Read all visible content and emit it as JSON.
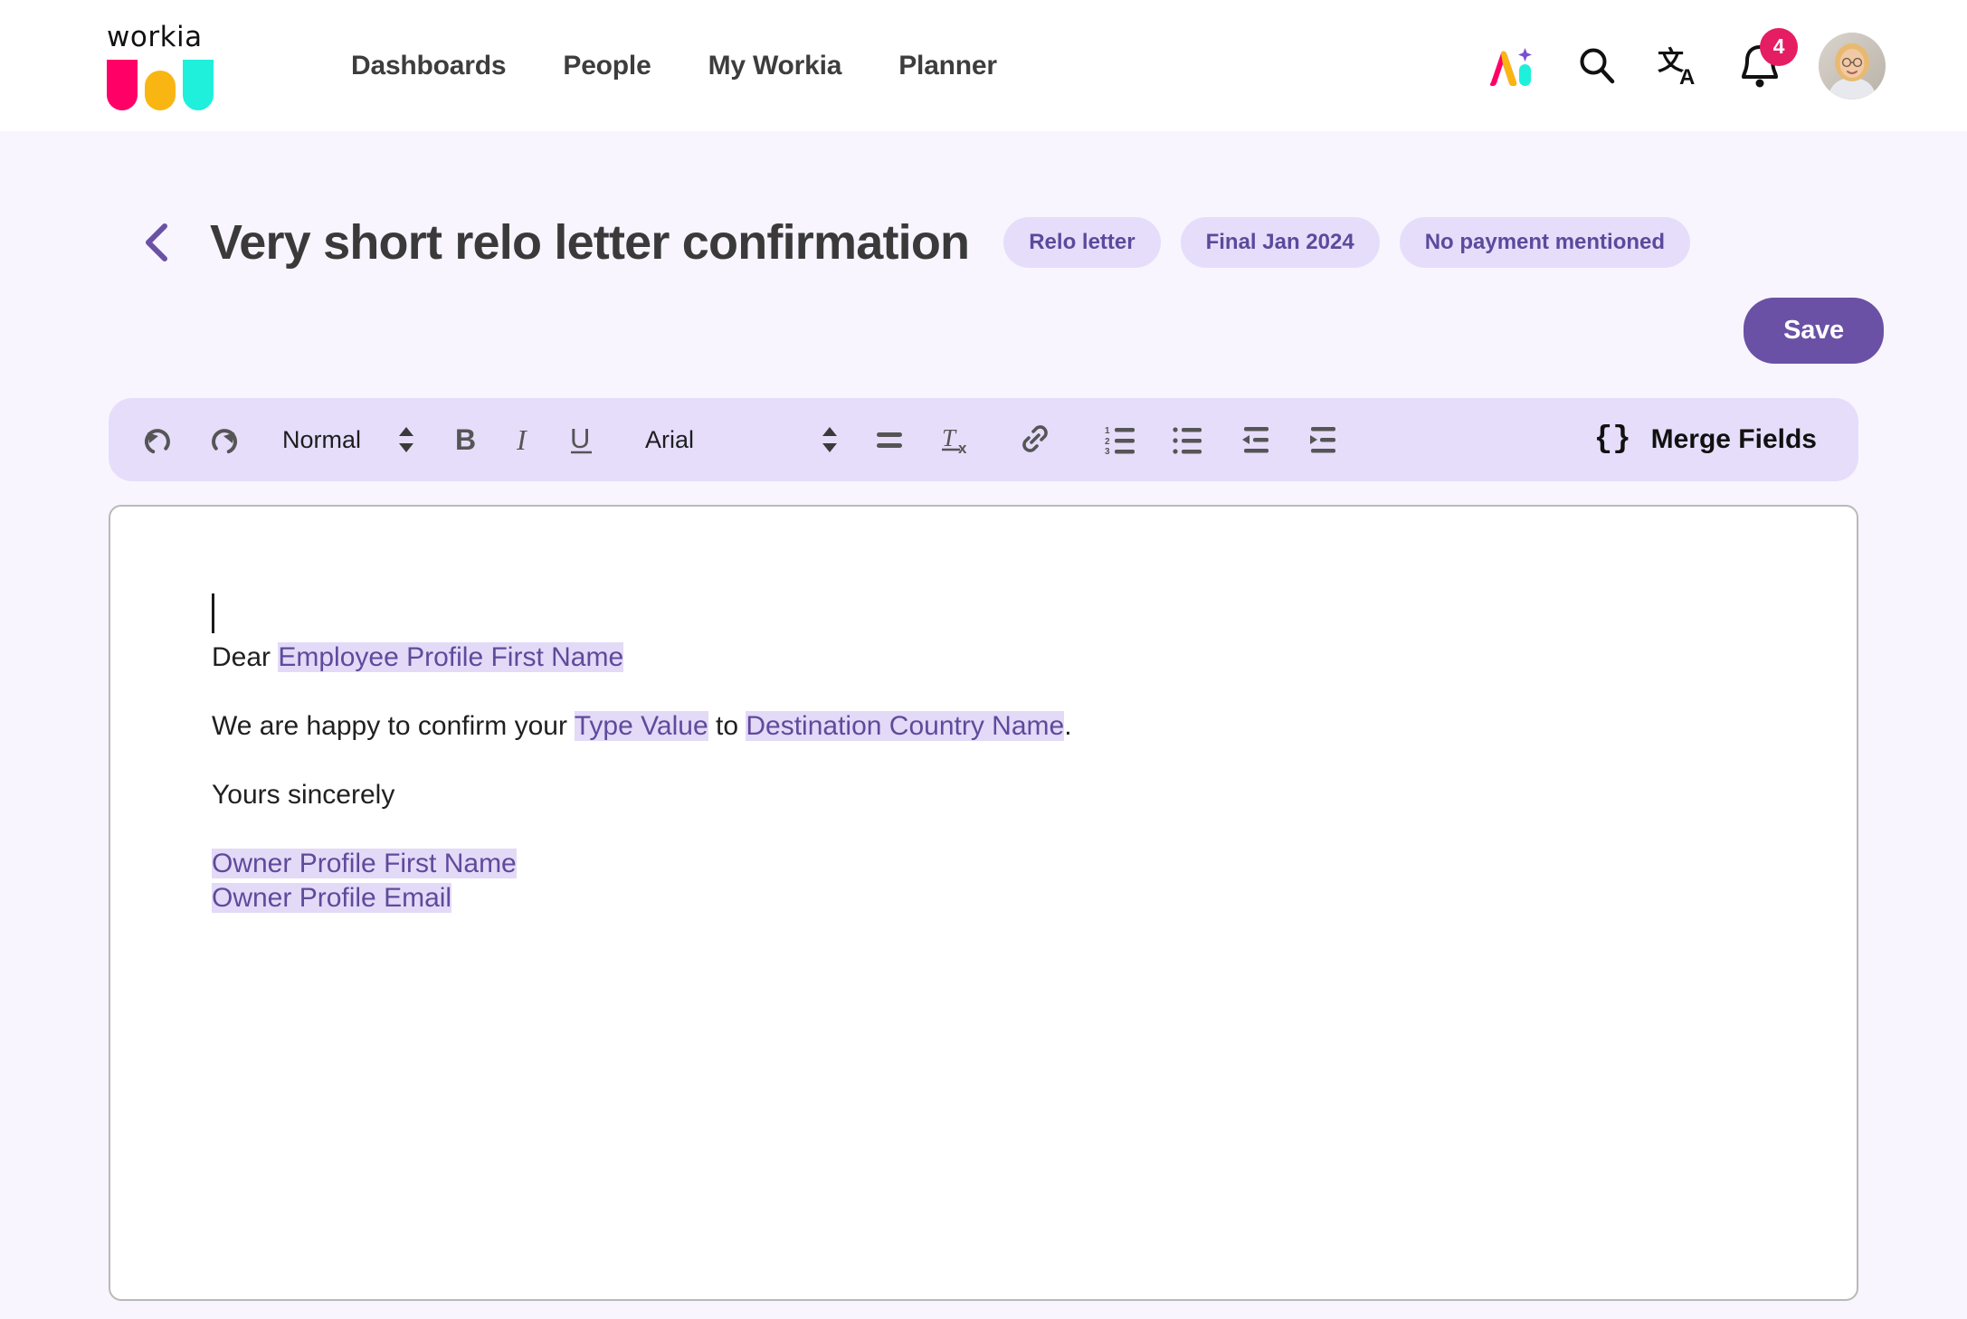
{
  "brand": {
    "logo_word": "workia",
    "logo_colors": [
      "#ff0066",
      "#f9b612",
      "#1ef0dc"
    ]
  },
  "header": {
    "nav": [
      {
        "label": "Dashboards"
      },
      {
        "label": "People"
      },
      {
        "label": "My Workia"
      },
      {
        "label": "Planner"
      }
    ],
    "actions": [
      {
        "name": "ai-assistant-icon"
      },
      {
        "name": "search-icon"
      },
      {
        "name": "translate-icon"
      },
      {
        "name": "notifications-bell-icon"
      },
      {
        "name": "user-avatar"
      }
    ],
    "notification_count": "4",
    "badge_color": "#e51d62"
  },
  "page": {
    "back_label": "Back",
    "title": "Very short relo letter confirmation",
    "tags": [
      {
        "label": "Relo letter"
      },
      {
        "label": "Final Jan 2024"
      },
      {
        "label": "No payment mentioned"
      }
    ],
    "save_label": "Save",
    "accent_color": "#6a51a5",
    "tag_bg": "#e6ddfb",
    "tag_text": "#5b4a9c"
  },
  "toolbar": {
    "undo": "undo-icon",
    "redo": "redo-icon",
    "block_style": "Normal",
    "bold": "B",
    "italic": "I",
    "underline": "U",
    "font_family": "Arial",
    "align": "align-icon",
    "clear_format": "clear-formatting-icon",
    "link": "link-icon",
    "ordered_list": "ordered-list-icon",
    "bullet_list": "bullet-list-icon",
    "outdent": "outdent-icon",
    "indent": "indent-icon",
    "merge_fields_label": "Merge Fields",
    "merge_fields_icon": "{}",
    "background": "#e6ddfb"
  },
  "document": {
    "merge_field_bg": "#e3daf8",
    "merge_field_text": "#5f4a9b",
    "lines": [
      {
        "segments": [
          {
            "text": "Dear ",
            "merge": false
          },
          {
            "text": "Employee Profile First Name",
            "merge": true
          }
        ]
      },
      {
        "segments": [
          {
            "text": "We are happy to confirm your ",
            "merge": false
          },
          {
            "text": "Type Value",
            "merge": true
          },
          {
            "text": " to ",
            "merge": false
          },
          {
            "text": "Destination Country Name",
            "merge": true
          },
          {
            "text": ".",
            "merge": false
          }
        ]
      },
      {
        "segments": [
          {
            "text": "Yours sincerely",
            "merge": false
          }
        ]
      },
      {
        "segments": [
          {
            "text": "Owner Profile First Name",
            "merge": true
          }
        ]
      },
      {
        "segments": [
          {
            "text": "Owner Profile Email",
            "merge": true
          }
        ]
      }
    ]
  }
}
